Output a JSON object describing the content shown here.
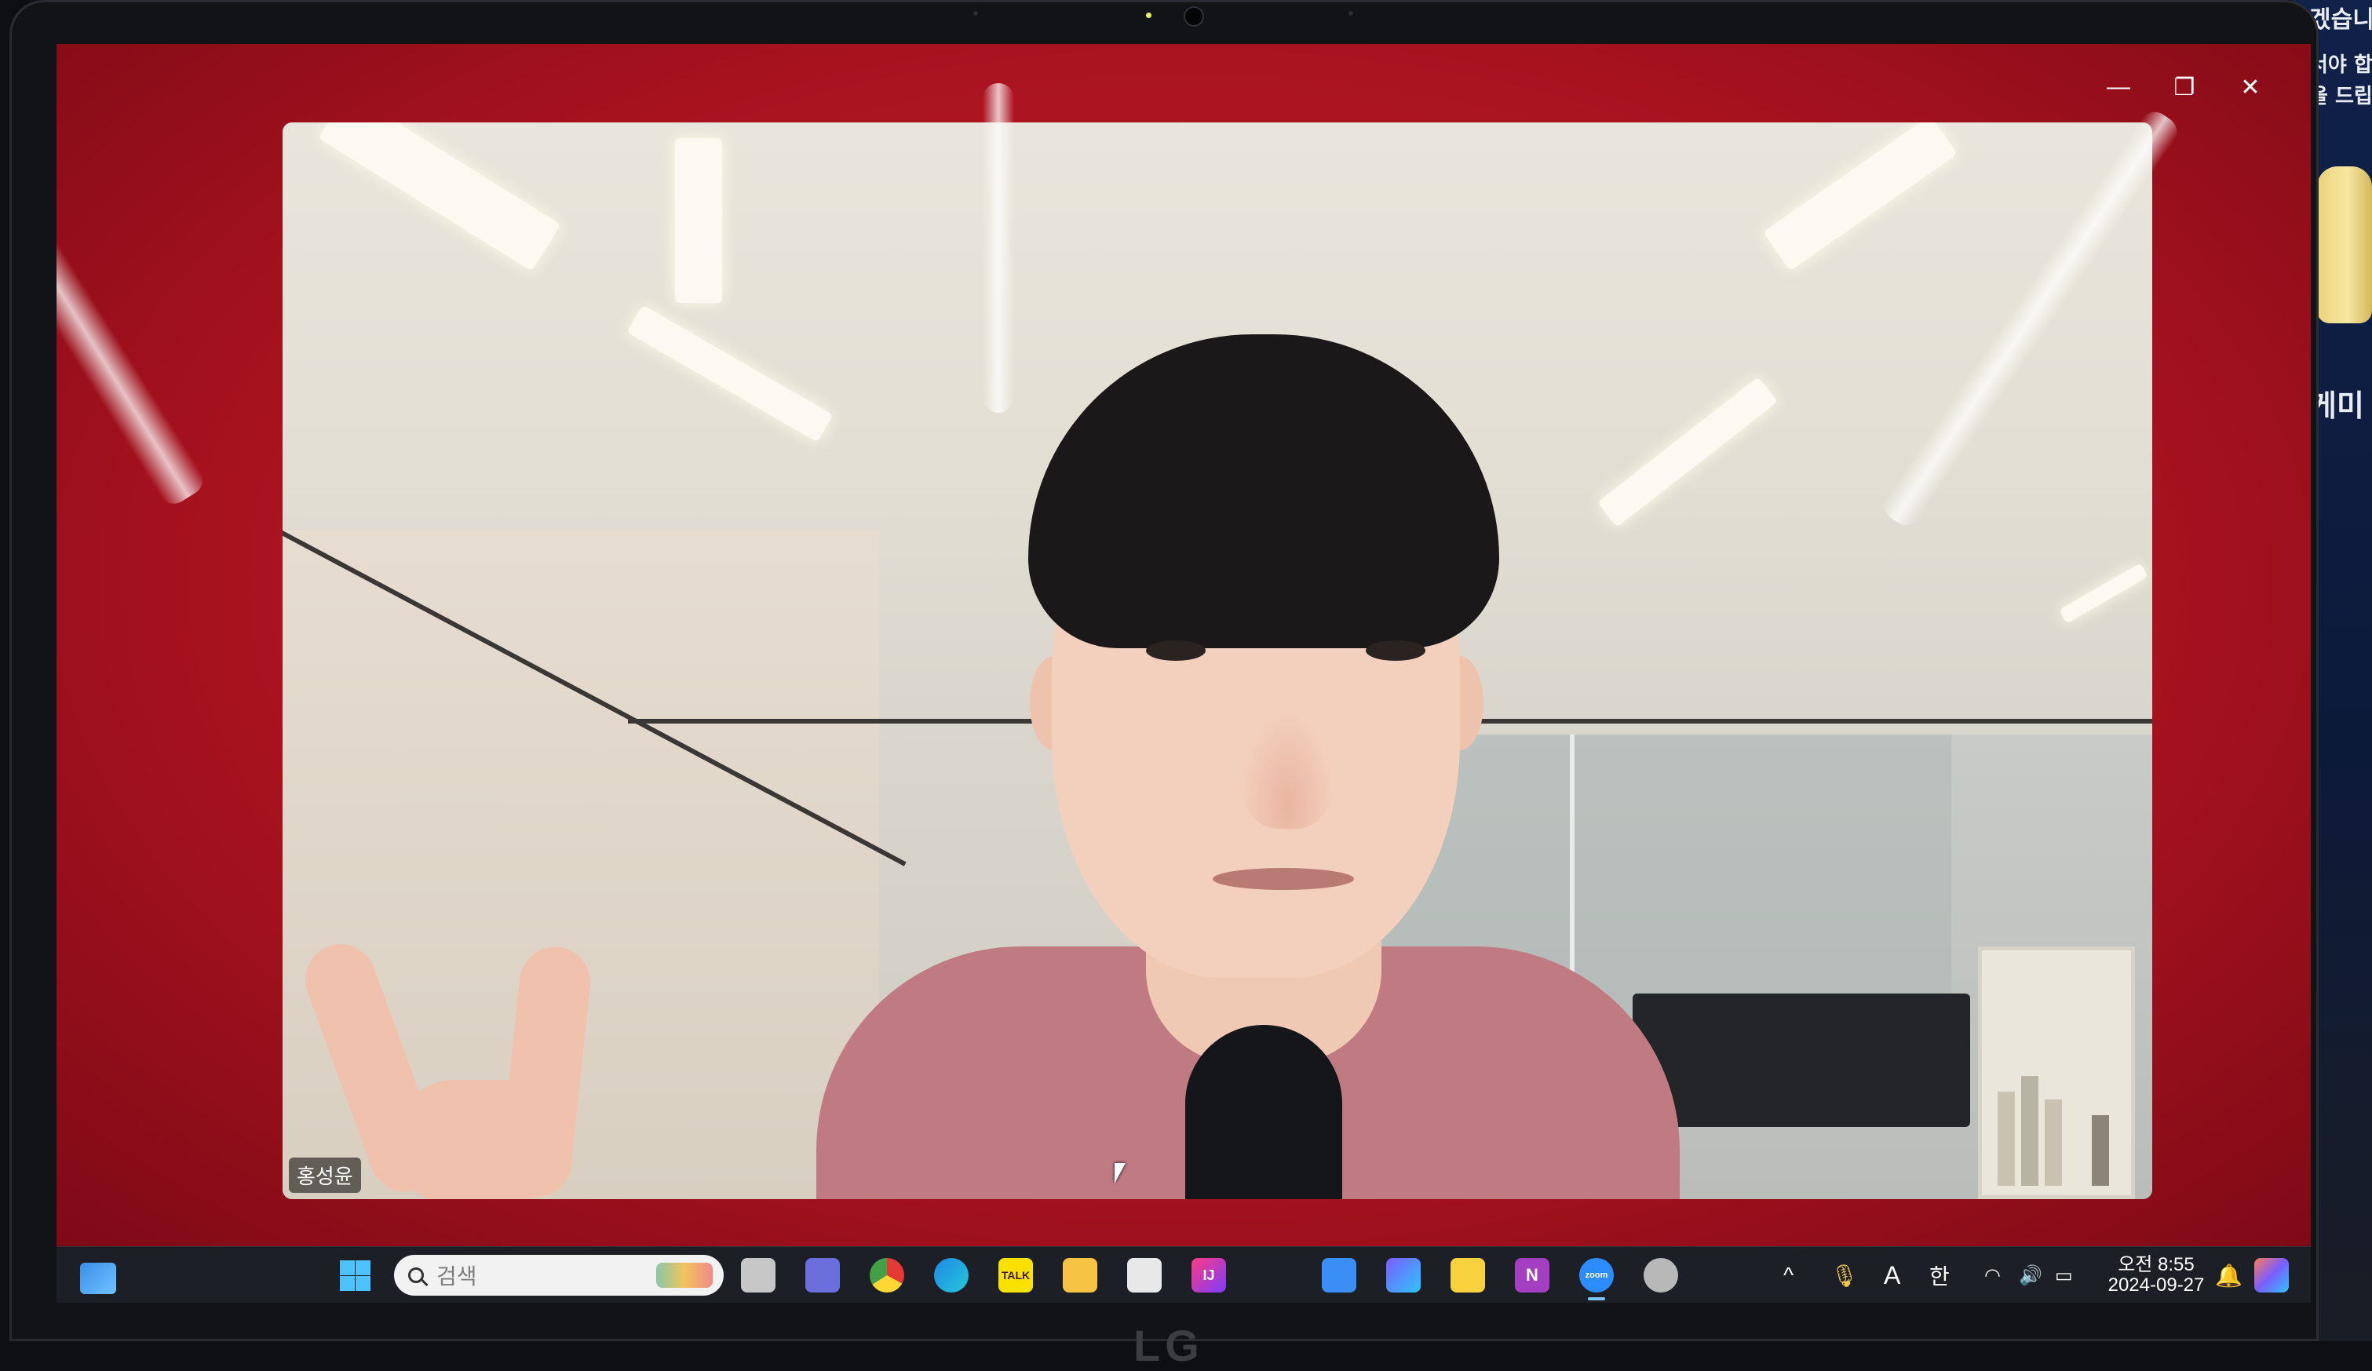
{
  "window": {
    "controls": {
      "minimize": "—",
      "restore": "❐",
      "close": "✕"
    }
  },
  "video": {
    "participant_name": "홍성윤"
  },
  "taskbar": {
    "search_placeholder": "검색",
    "apps": [
      {
        "name": "task-view",
        "color": "#c7c7c7"
      },
      {
        "name": "teams",
        "color": "#6b6fdc"
      },
      {
        "name": "chrome",
        "color": "#4caf50"
      },
      {
        "name": "edge",
        "color": "#1e88e5"
      },
      {
        "name": "kakaotalk",
        "label": "TALK",
        "color": "#fae100"
      },
      {
        "name": "file-explorer",
        "color": "#f6c343"
      },
      {
        "name": "app-generic",
        "color": "#e8e8e8"
      },
      {
        "name": "intellij",
        "label": "IJ",
        "color": "#ff3b7f"
      },
      {
        "name": "app-blue",
        "color": "#3b8ef5"
      },
      {
        "name": "clipchamp",
        "color": "#7a5cff"
      },
      {
        "name": "sticky-notes",
        "color": "#f7d23e"
      },
      {
        "name": "onenote",
        "label": "N",
        "color": "#a43fc2"
      },
      {
        "name": "zoom",
        "label": "zoom",
        "color": "#2d8cff"
      },
      {
        "name": "settings",
        "color": "#b8b8b8"
      }
    ],
    "tray": {
      "overflow": "^",
      "ime_letter": "A",
      "ime_lang": "한",
      "time": "오전 8:55",
      "date": "2024-09-27"
    }
  },
  "background": {
    "right_text_fragments": [
      "겠습니다",
      "서야 합",
      "을 드립",
      "케미"
    ]
  },
  "device": {
    "brand": "LG"
  }
}
